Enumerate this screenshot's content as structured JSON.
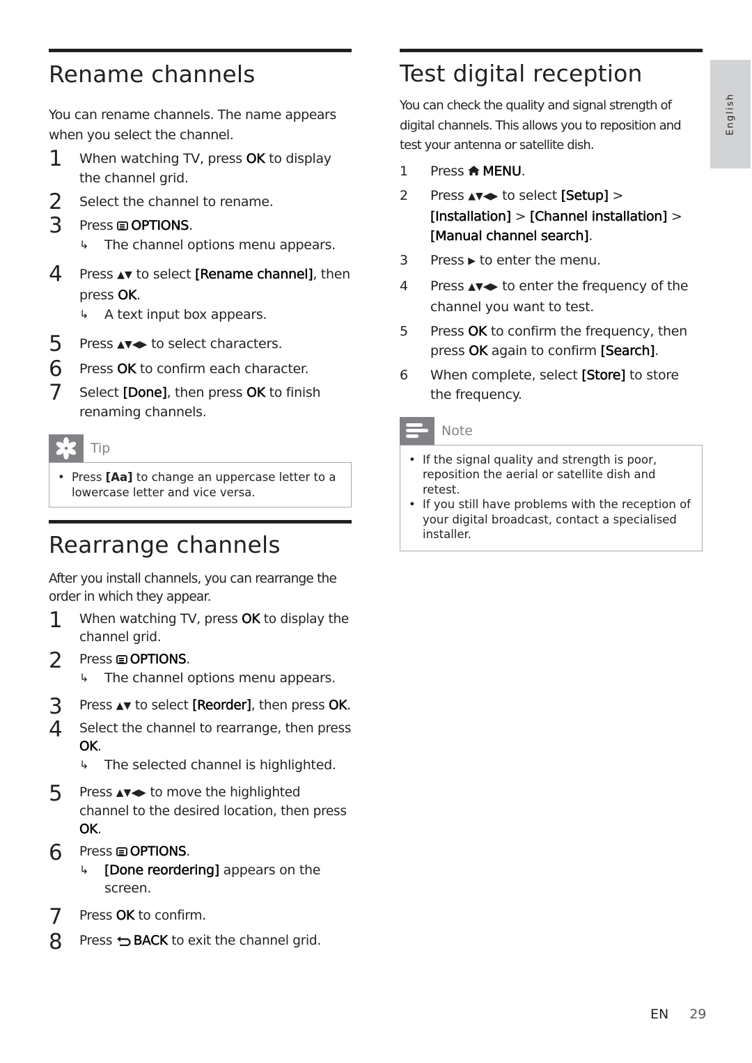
{
  "side_tab": {
    "label": "English"
  },
  "rename": {
    "title": "Rename channels",
    "intro": "You can rename channels. The name appears when you select the channel.",
    "steps": [
      {
        "num": "1",
        "parts": [
          "When watching TV, press ",
          "OK",
          " to display the channel grid."
        ]
      },
      {
        "num": "2",
        "text": "Select the channel to rename."
      },
      {
        "num": "3",
        "pre": "Press ",
        "key": "OPTIONS",
        "post": ".",
        "result": "The channel options menu appears."
      },
      {
        "num": "4",
        "a": "Press ",
        "b": " to select ",
        "c": "[Rename channel]",
        "d": ", then press ",
        "e": "OK",
        "f": ".",
        "result": "A text input box appears."
      },
      {
        "num": "5",
        "a": "Press ",
        "b": " to select characters."
      },
      {
        "num": "6",
        "a": "Press ",
        "b": "OK",
        "c": " to confirm each character."
      },
      {
        "num": "7",
        "a": "Select ",
        "b": "[Done]",
        "c": ", then press ",
        "d": "OK",
        "e": " to finish renaming channels."
      }
    ],
    "tip": {
      "title": "Tip",
      "pre": "Press ",
      "key": "[Aa]",
      "post": " to change an uppercase letter to a lowercase letter and vice versa."
    }
  },
  "rearrange": {
    "title": "Rearrange channels",
    "intro": "After you install channels, you can rearrange the order in which they appear.",
    "steps": [
      {
        "num": "1",
        "a": "When watching TV, press ",
        "b": "OK",
        "c": " to display the channel grid."
      },
      {
        "num": "2",
        "a": "Press ",
        "key": "OPTIONS",
        "c": ".",
        "result": "The channel options menu appears."
      },
      {
        "num": "3",
        "a": "Press ",
        "b": " to select ",
        "c": "[Reorder]",
        "d": ", then press ",
        "e": "OK",
        "f": "."
      },
      {
        "num": "4",
        "a": "Select the channel to rearrange, then press ",
        "b": "OK",
        "c": ".",
        "result": "The selected channel is highlighted."
      },
      {
        "num": "5",
        "a": "Press ",
        "b": " to move the highlighted channel to the desired location, then press ",
        "c": "OK",
        "d": "."
      },
      {
        "num": "6",
        "a": "Press ",
        "key": "OPTIONS",
        "c": ".",
        "result_bold": "[Done reordering]",
        "result": " appears on the screen."
      },
      {
        "num": "7",
        "a": "Press ",
        "b": "OK",
        "c": " to confirm."
      },
      {
        "num": "8",
        "a": "Press ",
        "key": "BACK",
        "c": " to exit the channel grid."
      }
    ]
  },
  "test": {
    "title": "Test digital reception",
    "intro": "You can check the quality and signal strength of digital channels. This allows you to reposition and test your antenna or satellite dish.",
    "steps": [
      {
        "num": "1",
        "a": "Press ",
        "key": "MENU",
        "c": "."
      },
      {
        "num": "2",
        "a": "Press ",
        "b": " to select ",
        "c": "[Setup]",
        "d": " > ",
        "e": "[Installation]",
        "f": " > ",
        "g": "[Channel installation]",
        "h": " > ",
        "i": "[Manual channel search]",
        "j": "."
      },
      {
        "num": "3",
        "a": "Press ",
        "b": " to enter the menu."
      },
      {
        "num": "4",
        "a": "Press ",
        "b": " to enter the frequency of the channel you want to test."
      },
      {
        "num": "5",
        "a": "Press ",
        "b": "OK",
        "c": " to confirm the frequency, then press ",
        "d": "OK",
        "e": " again to confirm ",
        "f": "[Search]",
        "g": "."
      },
      {
        "num": "6",
        "a": "When complete, select ",
        "b": "[Store]",
        "c": " to store the frequency."
      }
    ],
    "note": {
      "title": "Note",
      "items": [
        "If the signal quality and strength is poor, reposition the aerial or satellite dish and retest.",
        "If you still have problems with the reception of your digital broadcast, contact a specialised installer."
      ]
    }
  },
  "icons": {
    "up_down": "▲▼",
    "all_arrows": "▲▼◀▶",
    "right": "▶",
    "home": "⌂",
    "back": "⮌",
    "result_arrow": "↳"
  },
  "footer": {
    "lang": "EN",
    "page": "29"
  }
}
